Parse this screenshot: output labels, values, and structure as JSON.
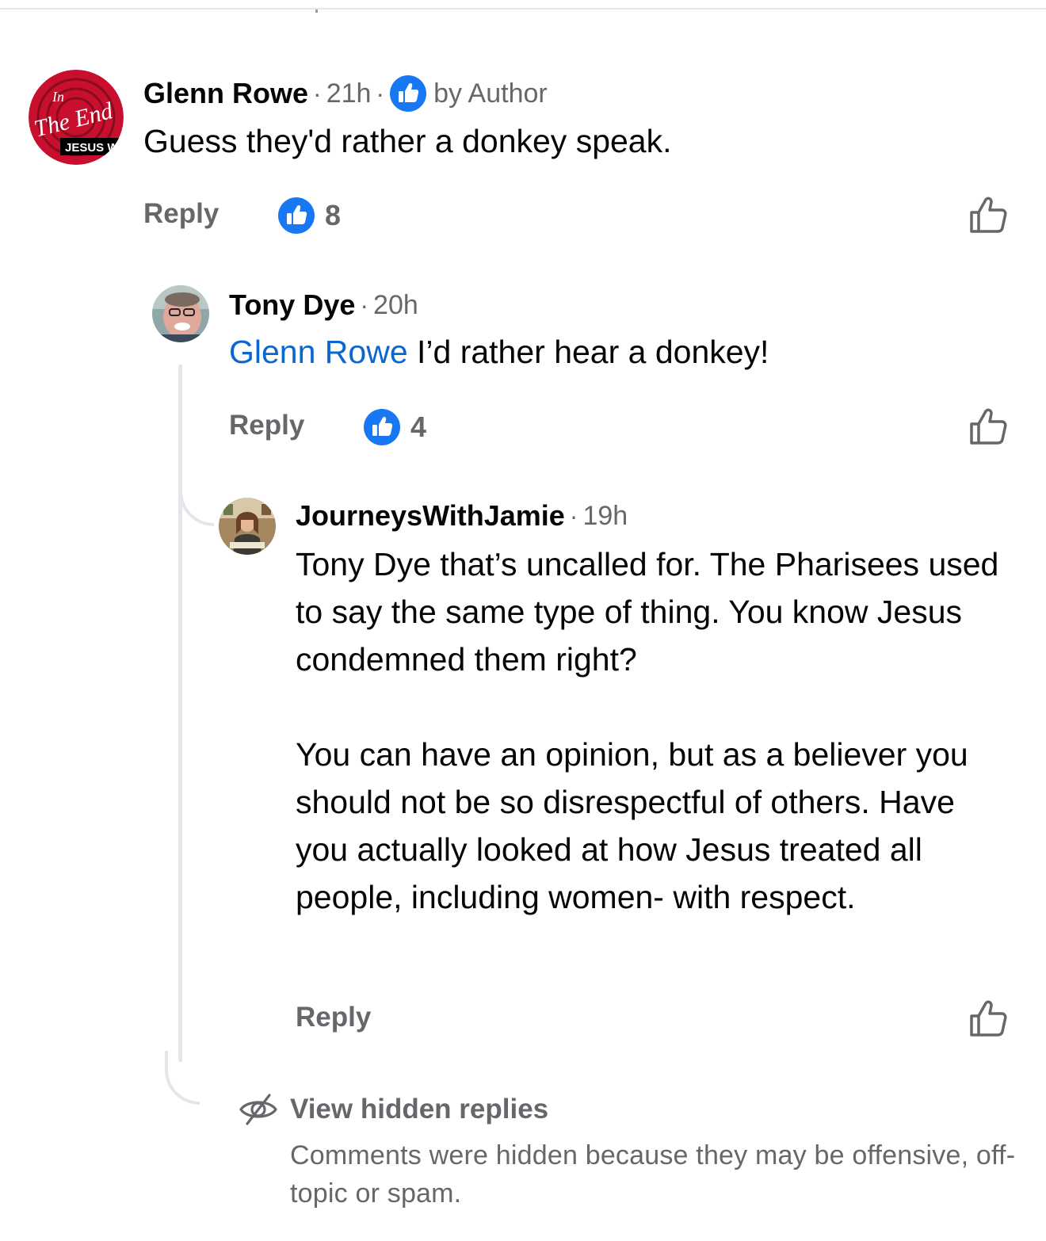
{
  "comment": {
    "author": "Glenn Rowe",
    "time": "21h",
    "author_like_label": "by Author",
    "text": "Guess they'd rather a donkey speak.",
    "reply_label": "Reply",
    "reaction_count": "8",
    "avatar_logo": {
      "line1": "In",
      "line2": "The End",
      "line3": "JESUS WI"
    },
    "colors": {
      "avatar_red": "#c8102e",
      "reaction_blue": "#1877f2"
    }
  },
  "reply1": {
    "author": "Tony Dye",
    "time": "20h",
    "mention": "Glenn Rowe",
    "text": " I’d rather hear a donkey!",
    "reply_label": "Reply",
    "reaction_count": "4"
  },
  "reply2": {
    "author": "JourneysWithJamie",
    "time": "19h",
    "text": "Tony Dye that’s uncalled for. The Pharisees used to say the same type of thing. You know Jesus condemned them right?\n\nYou can have an opinion, but as a believer you should not be so disrespectful of others. Have you actually looked at how Jesus treated all people, including women- with respect.",
    "reply_label": "Reply"
  },
  "hidden_replies": {
    "title": "View hidden replies",
    "description": "Comments were hidden because they may be offensive, off-topic or spam.",
    "icon": "eye-slash-icon"
  },
  "colors": {
    "link_blue": "#0a66d0",
    "meta_gray": "#65676b",
    "thread_line": "#e4e6eb"
  }
}
